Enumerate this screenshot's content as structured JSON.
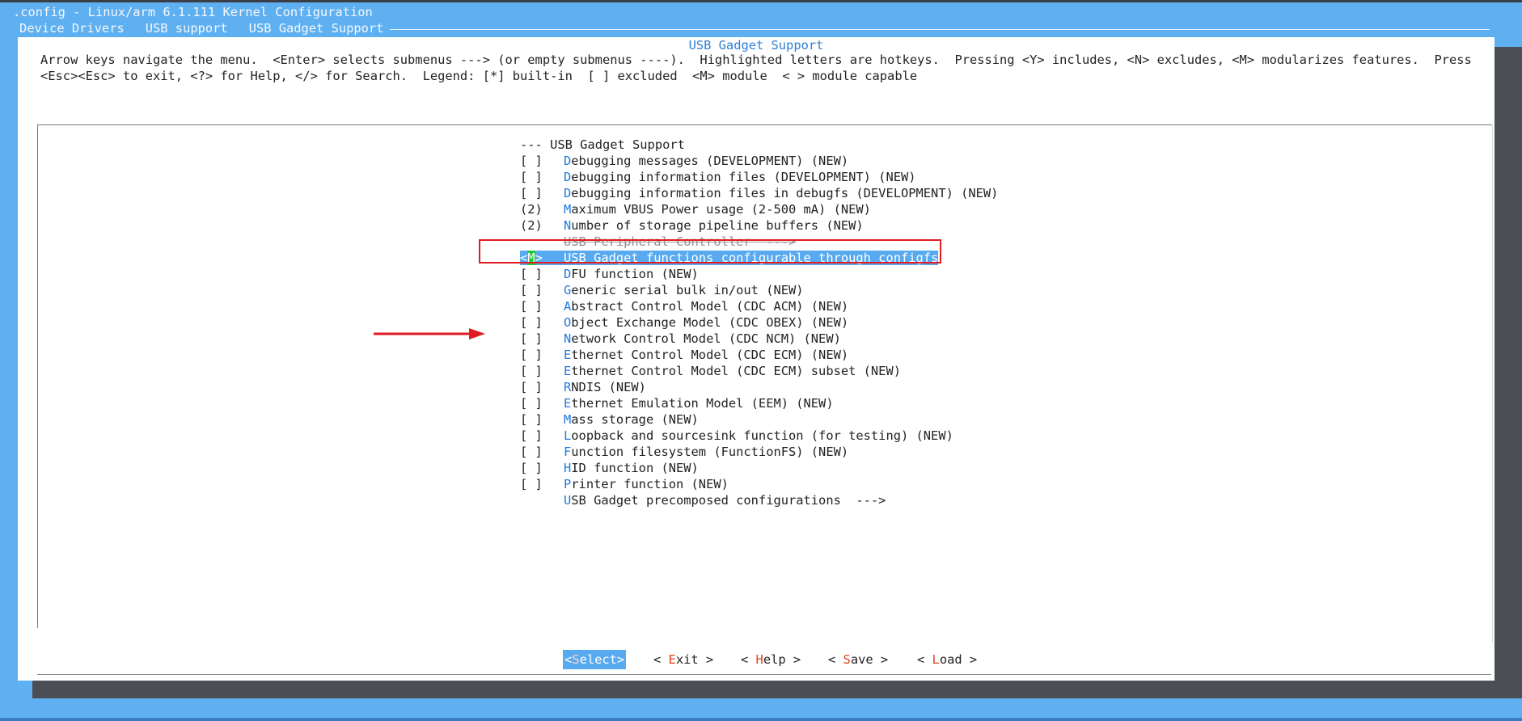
{
  "window": {
    "title": ".config - Linux/arm 6.1.111 Kernel Configuration",
    "breadcrumb": [
      "Device Drivers",
      "USB support",
      "USB Gadget Support"
    ]
  },
  "dialog": {
    "title": "USB Gadget Support",
    "help_line1": "Arrow keys navigate the menu.  <Enter> selects submenus ---> (or empty submenus ----).  Highlighted letters are hotkeys.  Pressing <Y> includes, <N> excludes, <M> modularizes features.  Press",
    "help_line2": "<Esc><Esc> to exit, <?> for Help, </> for Search.  Legend: [*] built-in  [ ] excluded  <M> module  < > module capable"
  },
  "menu": {
    "items": [
      {
        "mark": "---",
        "hotkey": "",
        "rest": "USB Gadget Support"
      },
      {
        "mark": "[ ]",
        "hotkey": "D",
        "rest": "ebugging messages (DEVELOPMENT) (NEW)"
      },
      {
        "mark": "[ ]",
        "hotkey": "D",
        "rest": "ebugging information files (DEVELOPMENT) (NEW)"
      },
      {
        "mark": "[ ]",
        "hotkey": "D",
        "rest": "ebugging information files in debugfs (DEVELOPMENT) (NEW)"
      },
      {
        "mark": "(2)",
        "hotkey": "M",
        "rest": "aximum VBUS Power usage (2-500 mA) (NEW)"
      },
      {
        "mark": "(2)",
        "hotkey": "N",
        "rest": "umber of storage pipeline buffers (NEW)"
      },
      {
        "mark": "",
        "hotkey": "",
        "rest": "USB Peripheral Controller  --->"
      },
      {
        "mark": "<M>",
        "hotkey": "U",
        "rest": "SB Gadget functions configurable through configfs"
      },
      {
        "mark": "[ ]",
        "hotkey": "D",
        "rest": "FU function (NEW)"
      },
      {
        "mark": "[ ]",
        "hotkey": "G",
        "rest": "eneric serial bulk in/out (NEW)"
      },
      {
        "mark": "[ ]",
        "hotkey": "A",
        "rest": "bstract Control Model (CDC ACM) (NEW)"
      },
      {
        "mark": "[ ]",
        "hotkey": "O",
        "rest": "bject Exchange Model (CDC OBEX) (NEW)"
      },
      {
        "mark": "[ ]",
        "hotkey": "N",
        "rest": "etwork Control Model (CDC NCM) (NEW)"
      },
      {
        "mark": "[ ]",
        "hotkey": "E",
        "rest": "thernet Control Model (CDC ECM) (NEW)"
      },
      {
        "mark": "[ ]",
        "hotkey": "E",
        "rest": "thernet Control Model (CDC ECM) subset (NEW)"
      },
      {
        "mark": "[ ]",
        "hotkey": "R",
        "rest": "NDIS (NEW)"
      },
      {
        "mark": "[ ]",
        "hotkey": "E",
        "rest": "thernet Emulation Model (EEM) (NEW)"
      },
      {
        "mark": "[ ]",
        "hotkey": "M",
        "rest": "ass storage (NEW)"
      },
      {
        "mark": "[ ]",
        "hotkey": "L",
        "rest": "oopback and sourcesink function (for testing) (NEW)"
      },
      {
        "mark": "[ ]",
        "hotkey": "F",
        "rest": "unction filesystem (FunctionFS) (NEW)"
      },
      {
        "mark": "[ ]",
        "hotkey": "H",
        "rest": "ID function (NEW)"
      },
      {
        "mark": "[ ]",
        "hotkey": "P",
        "rest": "rinter function (NEW)"
      },
      {
        "mark": "",
        "hotkey": "U",
        "rest": "SB Gadget precomposed configurations  --->"
      }
    ],
    "selected_index": 7
  },
  "buttons": [
    {
      "open": "<",
      "hotkey": "S",
      "rest": "elect",
      "close": ">"
    },
    {
      "open": "< ",
      "hotkey": "E",
      "rest": "xit",
      "close": " >"
    },
    {
      "open": "< ",
      "hotkey": "H",
      "rest": "elp",
      "close": " >"
    },
    {
      "open": "< ",
      "hotkey": "S",
      "rest": "ave",
      "close": " >"
    },
    {
      "open": "< ",
      "hotkey": "L",
      "rest": "oad",
      "close": " >"
    }
  ],
  "colors": {
    "terminal_bg": "#5fb0f0",
    "selection": "#58aaf0",
    "hotkey_menu": "#1f7ae0",
    "hotkey_button": "#e0411a",
    "annotation_red": "#e01b24"
  }
}
